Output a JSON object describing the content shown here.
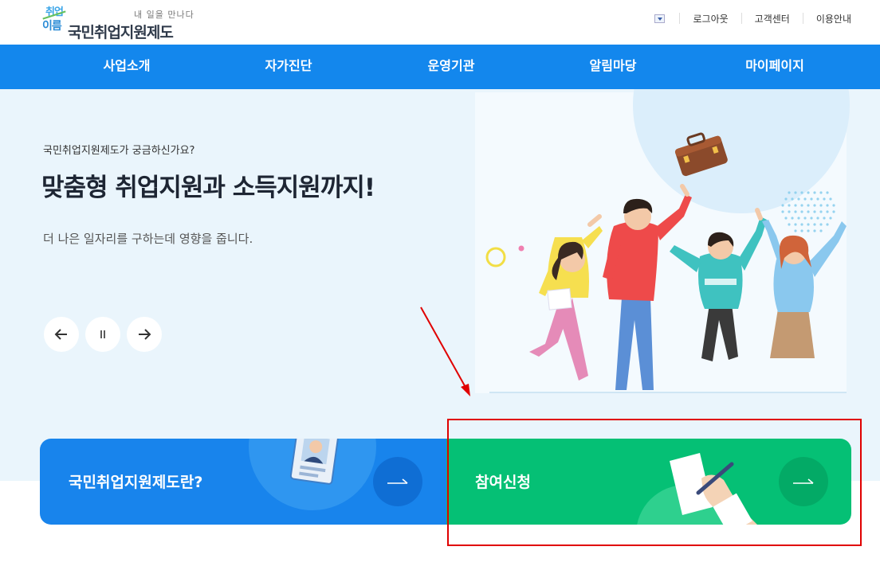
{
  "header": {
    "logo": {
      "mark_line1": "취업",
      "mark_line2": "이름",
      "tagline": "내 일을 만나다",
      "title": "국민취업지원제도"
    },
    "util_links": [
      "로그아웃",
      "고객센터",
      "이용안내"
    ],
    "language_dropdown_icon": "chevron-down-icon"
  },
  "nav": {
    "items": [
      "사업소개",
      "자가진단",
      "운영기관",
      "알림마당",
      "마이페이지"
    ]
  },
  "hero": {
    "eyebrow": "국민취업지원제도가 궁금하신가요?",
    "headline": "맞춤형 취업지원과 소득지원까지!",
    "description": "더 나은 일자리를 구하는데 영향을 줍니다.",
    "controls": {
      "prev_icon": "arrow-left-icon",
      "pause_icon": "pause-icon",
      "next_icon": "arrow-right-icon"
    }
  },
  "cards": {
    "intro": {
      "title": "국민취업지원제도란?",
      "icon": "id-badge-icon",
      "arrow_icon": "arrow-right-icon"
    },
    "apply": {
      "title": "참여신청",
      "icon": "signing-hand-icon",
      "arrow_icon": "arrow-right-icon"
    }
  },
  "colors": {
    "nav_bg": "#1387ed",
    "hero_bg": "#eaf5fc",
    "card_blue": "#1884ec",
    "card_green": "#05c075",
    "annotation": "#e00000"
  }
}
